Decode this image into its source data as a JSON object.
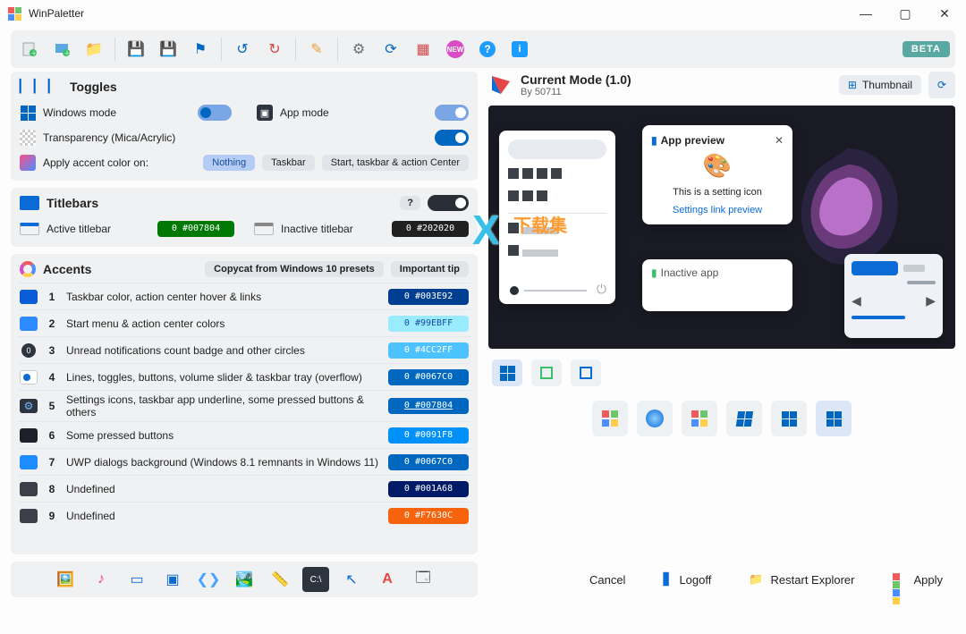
{
  "app": {
    "title": "WinPaletter",
    "beta": "BETA"
  },
  "toggles": {
    "heading": "Toggles",
    "windows_mode": "Windows mode",
    "app_mode": "App mode",
    "transparency": "Transparency (Mica/Acrylic)",
    "apply_accent_on": "Apply accent color on:",
    "accent_opts": {
      "nothing": "Nothing",
      "taskbar": "Taskbar",
      "full": "Start, taskbar & action Center"
    }
  },
  "titlebars": {
    "heading": "Titlebars",
    "active": "Active titlebar",
    "active_val": "0 #007804",
    "inactive": "Inactive titlebar",
    "inactive_val": "0 #202020"
  },
  "accents": {
    "heading": "Accents",
    "copycat": "Copycat from Windows 10 presets",
    "tip": "Important tip",
    "rows": [
      {
        "n": "1",
        "label": "Taskbar color, action center hover & links",
        "val": "0 #003E92",
        "bg": "#003e92",
        "ic": "#0a5bd6"
      },
      {
        "n": "2",
        "label": "Start menu & action center colors",
        "val": "0 #99EBFF",
        "bg": "#99ebff",
        "ic": "#2e8bff"
      },
      {
        "n": "3",
        "label": "Unread notifications count badge and other circles",
        "val": "0 #4CC2FF",
        "bg": "#4cc2ff",
        "ic": "#2d343d"
      },
      {
        "n": "4",
        "label": "Lines, toggles, buttons, volume slider & taskbar tray (overflow)",
        "val": "0 #0067C0",
        "bg": "#0067c0",
        "ic": "#0a6ad6"
      },
      {
        "n": "5",
        "label": "Settings icons, taskbar app underline, some pressed buttons & others",
        "val": "0 #007804",
        "bg": "#0067c0",
        "ic": "#2d343d"
      },
      {
        "n": "6",
        "label": "Some pressed buttons",
        "val": "0 #0091F8",
        "bg": "#0091f8",
        "ic": "#1d2027"
      },
      {
        "n": "7",
        "label": "UWP dialogs background (Windows 8.1 remnants in Windows 11)",
        "val": "0 #0067C0",
        "bg": "#0067c0",
        "ic": "#1d8cff"
      },
      {
        "n": "8",
        "label": "Undefined",
        "val": "0 #001A68",
        "bg": "#001a68",
        "ic": "#3b4048"
      },
      {
        "n": "9",
        "label": "Undefined",
        "val": "0 #F7630C",
        "bg": "#f7630c",
        "ic": "#3b4048"
      }
    ]
  },
  "mode": {
    "title": "Current Mode (1.0)",
    "by": "By 50711",
    "thumbnail": "Thumbnail"
  },
  "preview": {
    "app_title": "App preview",
    "setting_msg": "This is a setting icon",
    "link": "Settings link preview",
    "inactive": "Inactive app"
  },
  "footer": {
    "cancel": "Cancel",
    "logoff": "Logoff",
    "restart": "Restart Explorer",
    "apply": "Apply"
  },
  "watermark": {
    "x": "X",
    "text": "下载集"
  }
}
